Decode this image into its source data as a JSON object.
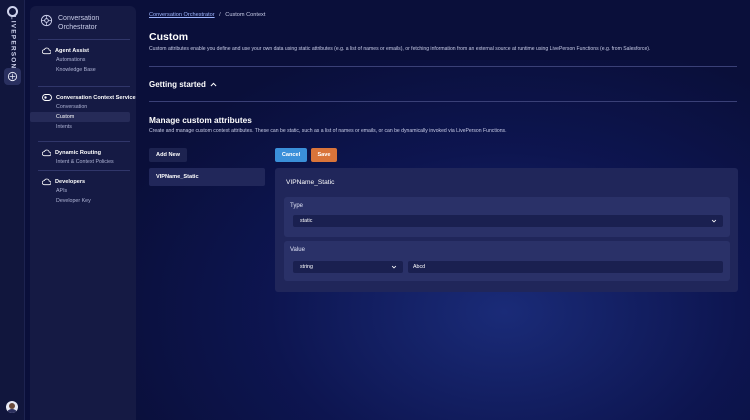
{
  "rail": {
    "brand": "LIVEPERSON"
  },
  "app": {
    "title": "Conversation Orchestrator"
  },
  "sidebar": {
    "sections": [
      {
        "title": "Agent Assist",
        "items": [
          "Automations",
          "Knowledge Base"
        ]
      },
      {
        "title": "Conversation Context Service",
        "items": [
          "Conversation",
          "Custom",
          "Intents"
        ],
        "active": "Custom"
      },
      {
        "title": "Dynamic Routing",
        "items": [
          "Intent & Context Policies"
        ]
      },
      {
        "title": "Developers",
        "items": [
          "APIs",
          "Developer Key"
        ]
      }
    ]
  },
  "breadcrumb": {
    "root": "Conversation Orchestrator",
    "separator": "/",
    "current": "Custom Context"
  },
  "page": {
    "title": "Custom",
    "description": "Custom attributes enable you define and use your own data using static attributes (e.g. a list of names or emails), or fetching information from an external source at runtime using LivePerson Functions (e.g. from Salesforce).",
    "getting_started": "Getting started"
  },
  "manage": {
    "title": "Manage custom attributes",
    "description": "Create and manage custom context attributes. These can be static, such as a list of names or emails, or can be dynamically invoked via LivePerson Functions.",
    "add_new": "Add New",
    "cancel": "Cancel",
    "save": "Save"
  },
  "attributes": [
    {
      "name": "VIPName_Static"
    }
  ],
  "editor": {
    "name": "VIPName_Static",
    "type_label": "Type",
    "type_value": "static",
    "value_label": "Value",
    "value_type": "string",
    "value": "Abcd"
  },
  "colors": {
    "background": "#0a0f3a",
    "sidebar": "#151a44",
    "cancel": "#3a8fd9",
    "save": "#d9743a"
  }
}
